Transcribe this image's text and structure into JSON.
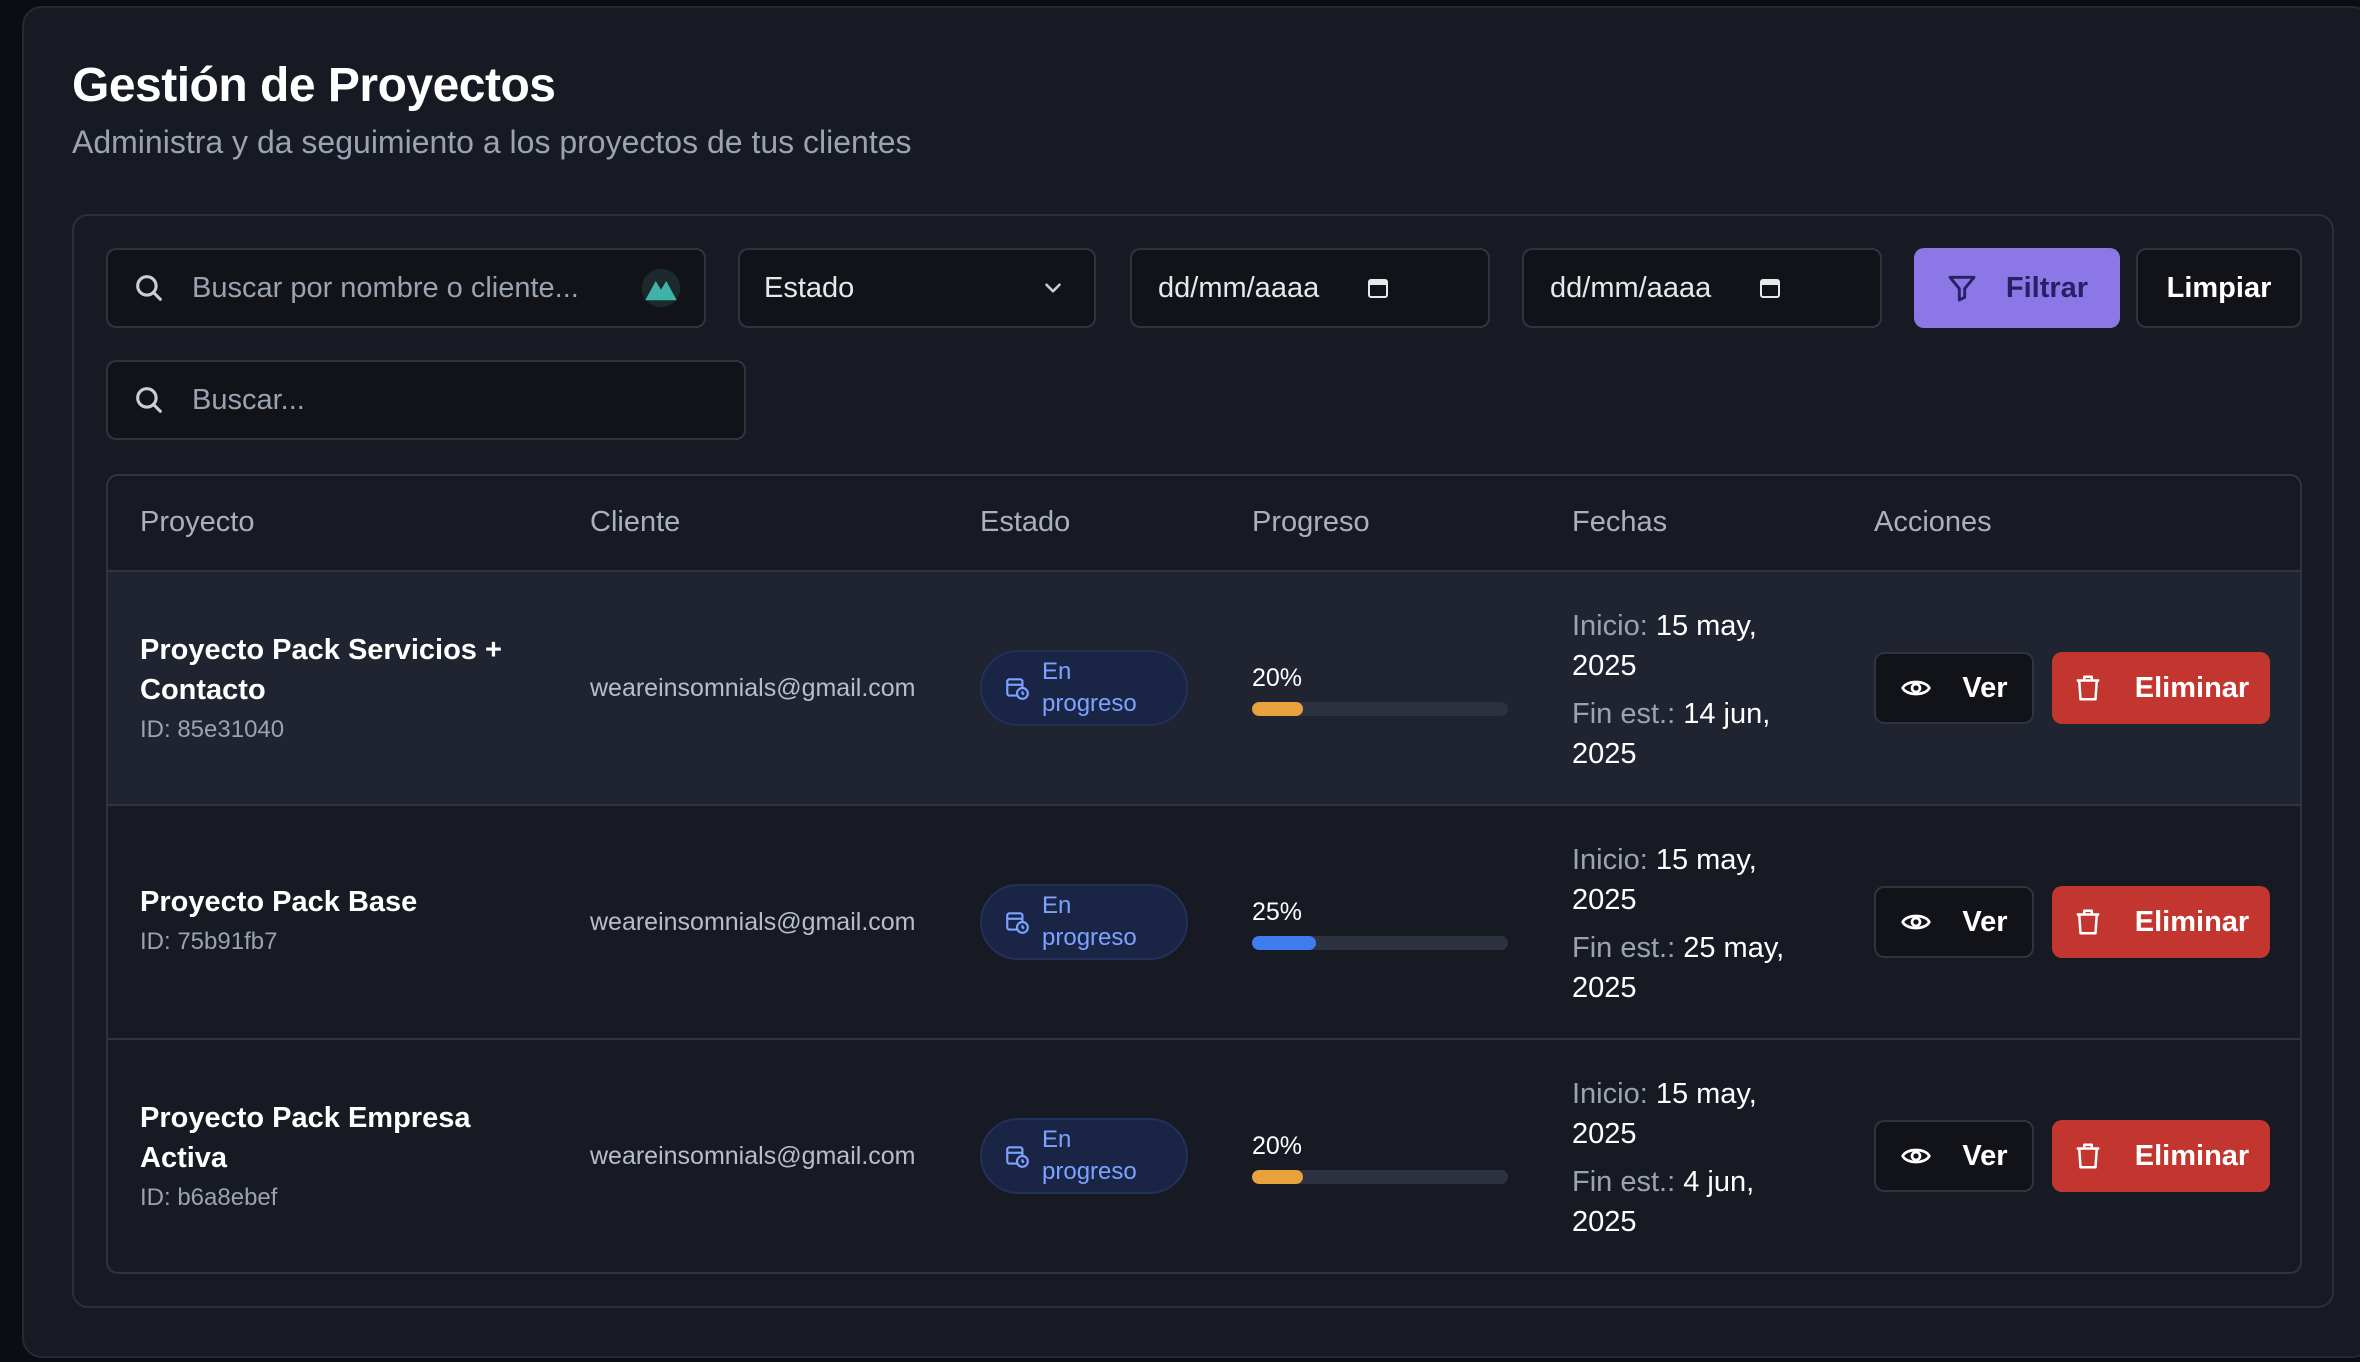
{
  "header": {
    "title": "Gestión de Proyectos",
    "subtitle": "Administra y da seguimiento a los proyectos de tus clientes"
  },
  "filters": {
    "search_placeholder": "Buscar por nombre o cliente...",
    "status_label": "Estado",
    "date_from_placeholder": "dd/mm/aaaa",
    "date_to_placeholder": "dd/mm/aaaa",
    "filter_label": "Filtrar",
    "clear_label": "Limpiar",
    "quick_search_placeholder": "Buscar..."
  },
  "table": {
    "columns": [
      "Proyecto",
      "Cliente",
      "Estado",
      "Progreso",
      "Fechas",
      "Acciones"
    ],
    "start_label": "Inicio:",
    "end_label": "Fin est.:",
    "view_label": "Ver",
    "delete_label": "Eliminar",
    "rows": [
      {
        "name": "Proyecto Pack Servicios + Contacto",
        "id": "ID: 85e31040",
        "client": "weareinsomnials@gmail.com",
        "status": "En progreso",
        "progress_text": "20%",
        "progress": 0.2,
        "progress_color": "#e9a23b",
        "start": "15 may, 2025",
        "end": "14 jun, 2025"
      },
      {
        "name": "Proyecto Pack Base",
        "id": "ID: 75b91fb7",
        "client": "weareinsomnials@gmail.com",
        "status": "En progreso",
        "progress_text": "25%",
        "progress": 0.25,
        "progress_color": "#3f7cf0",
        "start": "15 may, 2025",
        "end": "25 may, 2025"
      },
      {
        "name": "Proyecto Pack Empresa Activa",
        "id": "ID: b6a8ebef",
        "client": "weareinsomnials@gmail.com",
        "status": "En progreso",
        "progress_text": "20%",
        "progress": 0.2,
        "progress_color": "#e9a23b",
        "start": "15 may, 2025",
        "end": "4 jun, 2025"
      }
    ]
  },
  "colors": {
    "accent": "#8b78e6",
    "danger": "#c2362f",
    "badge_text": "#7ba2ff"
  }
}
